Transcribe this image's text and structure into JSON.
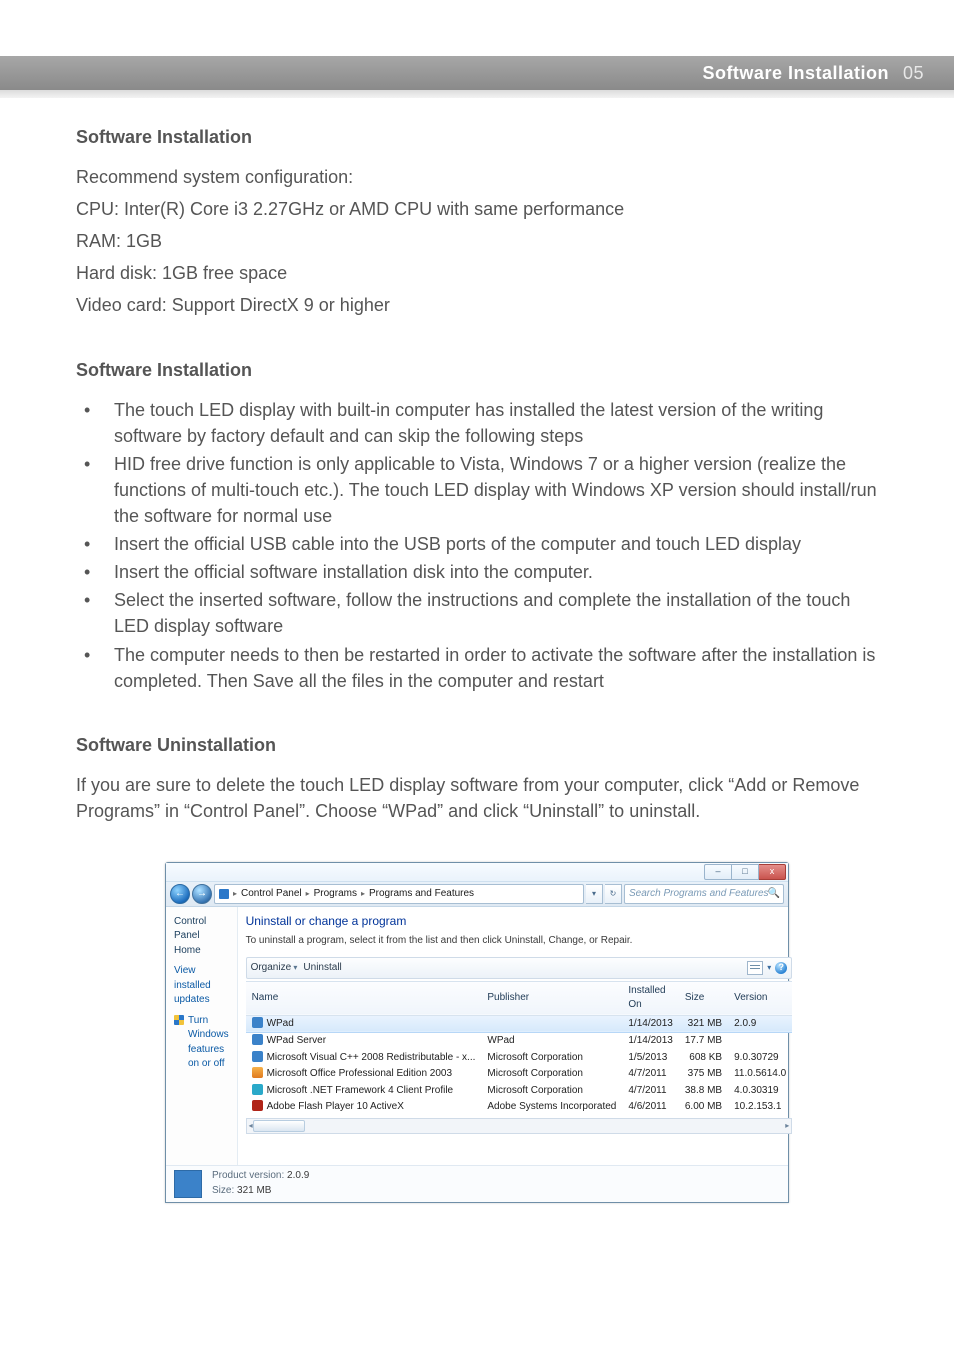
{
  "header": {
    "title": "Software Installation",
    "page_no": "05"
  },
  "section1": {
    "heading": "Software Installation",
    "lines": [
      "Recommend system configuration:",
      "CPU: Inter(R) Core i3 2.27GHz or AMD CPU with same performance",
      "RAM: 1GB",
      "Hard disk: 1GB free space",
      "Video card: Support DirectX 9 or higher"
    ]
  },
  "section2": {
    "heading": "Software Installation",
    "bullets": [
      "The touch LED display with built-in computer has installed the latest version of the writing software by factory default and can skip the following steps",
      "HID free drive function is only applicable to Vista, Windows 7 or a higher version (realize the functions of multi-touch etc.). The touch LED display with Windows XP version should install/run the software for normal use",
      "Insert the official USB cable into the USB ports of the computer and touch LED display",
      "Insert the official software installation disk into the computer.",
      "Select the inserted software, follow the instructions and complete the installation of the touch LED display software",
      "The computer needs to then be restarted in order to activate the software after the installation is completed. Then Save all the files in the computer and restart"
    ]
  },
  "section3": {
    "heading": "Software Uninstallation",
    "para": "If you are sure to delete the touch LED display software from your computer, click “Add or Remove Programs” in “Control Panel”. Choose “WPad” and click “Uninstall” to uninstall."
  },
  "win": {
    "caption_buttons": {
      "min": "–",
      "max": "□",
      "close": "x"
    },
    "breadcrumb": [
      "Control Panel",
      "Programs",
      "Programs and Features"
    ],
    "search_placeholder": "Search Programs and Features",
    "sidebar": {
      "home": "Control Panel Home",
      "links": [
        "View installed updates",
        "Turn Windows features on or off"
      ]
    },
    "main_title": "Uninstall or change a program",
    "main_sub": "To uninstall a program, select it from the list and then click Uninstall, Change, or Repair.",
    "toolbar": {
      "organize": "Organize",
      "uninstall": "Uninstall"
    },
    "columns": [
      "Name",
      "Publisher",
      "Installed On",
      "Size",
      "Version"
    ],
    "rows": [
      {
        "icon": "ic-blue",
        "name": "WPad",
        "publisher": "",
        "installed": "1/14/2013",
        "size": "321 MB",
        "version": "2.0.9",
        "selected": true
      },
      {
        "icon": "ic-blue",
        "name": "WPad Server",
        "publisher": "WPad",
        "installed": "1/14/2013",
        "size": "17.7 MB",
        "version": ""
      },
      {
        "icon": "ic-blue",
        "name": "Microsoft Visual C++ 2008 Redistributable - x...",
        "publisher": "Microsoft Corporation",
        "installed": "1/5/2013",
        "size": "608 KB",
        "version": "9.0.30729"
      },
      {
        "icon": "ic-orange",
        "name": "Microsoft Office Professional Edition 2003",
        "publisher": "Microsoft Corporation",
        "installed": "4/7/2011",
        "size": "375 MB",
        "version": "11.0.5614.0"
      },
      {
        "icon": "ic-teal",
        "name": "Microsoft .NET Framework 4 Client Profile",
        "publisher": "Microsoft Corporation",
        "installed": "4/7/2011",
        "size": "38.8 MB",
        "version": "4.0.30319"
      },
      {
        "icon": "ic-flash",
        "name": "Adobe Flash Player 10 ActiveX",
        "publisher": "Adobe Systems Incorporated",
        "installed": "4/6/2011",
        "size": "6.00 MB",
        "version": "10.2.153.1"
      }
    ],
    "details": {
      "product_version_label": "Product version:",
      "product_version": "2.0.9",
      "size_label": "Size:",
      "size": "321 MB"
    }
  }
}
